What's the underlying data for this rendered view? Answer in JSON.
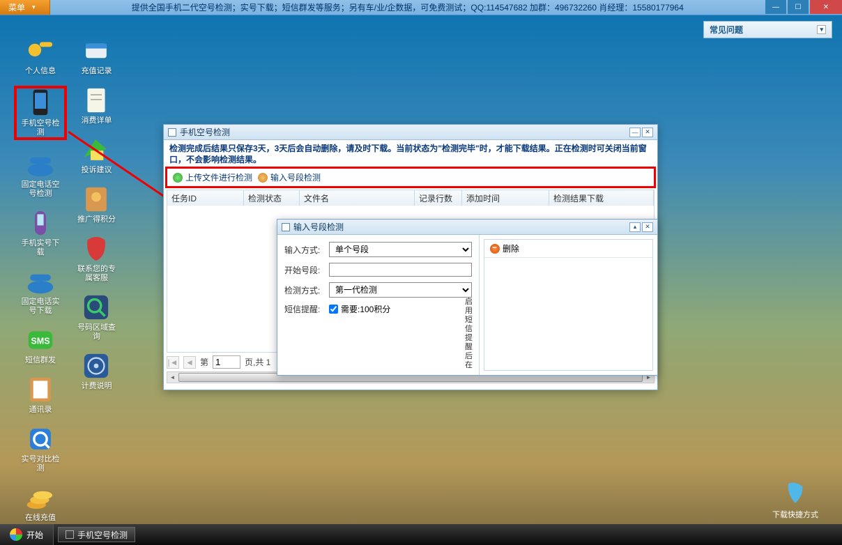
{
  "topbar": {
    "menu_label": "菜单",
    "banner": "提供全国手机二代空号检测；实号下载；短信群发等服务；另有车/业/企数据，可免费测试；QQ:114547682 加群：496732260 肖经理：15580177964"
  },
  "faq": {
    "title": "常见问题"
  },
  "icons_col1": [
    {
      "id": "personal-info",
      "label": "个人信息"
    },
    {
      "id": "mobile-empty-detect",
      "label": "手机空号检\n测",
      "hl": true
    },
    {
      "id": "landline-empty-detect",
      "label": "固定电话空\n号检测"
    },
    {
      "id": "mobile-real-download",
      "label": "手机实号下\n载"
    },
    {
      "id": "landline-real-download",
      "label": "固定电话实\n号下载"
    },
    {
      "id": "sms-bulk",
      "label": "短信群发"
    },
    {
      "id": "address-book",
      "label": "通讯录"
    },
    {
      "id": "real-compare",
      "label": "实号对比检\n测"
    },
    {
      "id": "online-recharge",
      "label": "在线充值"
    }
  ],
  "icons_col2": [
    {
      "id": "recharge-log",
      "label": "充值记录"
    },
    {
      "id": "consumption-list",
      "label": "消费详单"
    },
    {
      "id": "complaint",
      "label": "投诉建议"
    },
    {
      "id": "promo-points",
      "label": "推广得积分"
    },
    {
      "id": "contact-cs",
      "label": "联系您的专\n属客服"
    },
    {
      "id": "area-query",
      "label": "号码区域查\n询"
    },
    {
      "id": "billing",
      "label": "计费说明"
    }
  ],
  "detect_window": {
    "title": "手机空号检测",
    "notice": "检测完成后结果只保存3天，3天后会自动删除，请及时下载。当前状态为\"检测完毕\"时，才能下载结果。正在检测时可关闭当前窗口，不会影响检测结果。",
    "btn_upload": "上传文件进行检测",
    "btn_segment": "输入号段检测",
    "cols": {
      "c1": "任务ID",
      "c2": "检测状态",
      "c3": "文件名",
      "c4": "记录行数",
      "c5": "添加时间",
      "c6": "检测结果下载"
    },
    "pager_prefix": "第",
    "pager_value": "1",
    "pager_suffix": "页,共 1"
  },
  "seg_window": {
    "title": "输入号段检测",
    "f_input_mode": "输入方式:",
    "v_input_mode": "单个号段",
    "f_start": "开始号段:",
    "f_method": "检测方式:",
    "v_method": "第一代检测",
    "f_sms": "短信提醒:",
    "v_sms_note": "需要:100积分",
    "vertical_hint": "启用短信提醒后在",
    "delete_label": "删除"
  },
  "shortcut": {
    "label": "下载快捷方式"
  },
  "taskbar": {
    "start": "开始",
    "task1": "手机空号检测"
  }
}
